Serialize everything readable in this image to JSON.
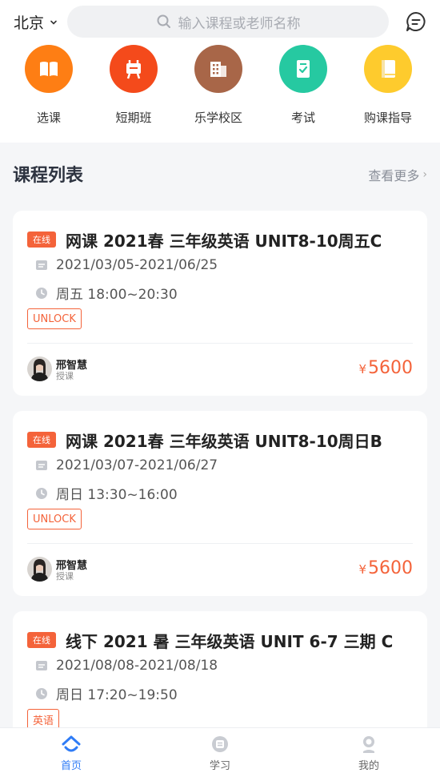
{
  "header": {
    "city": "北京",
    "search_placeholder": "输入课程或老师名称"
  },
  "categories": [
    {
      "label": "选课",
      "color": "#fe7e14",
      "icon": "book-icon"
    },
    {
      "label": "短期班",
      "color": "#f44a1b",
      "icon": "easel-icon"
    },
    {
      "label": "乐学校区",
      "color": "#a86648",
      "icon": "building-icon"
    },
    {
      "label": "考试",
      "color": "#26c9a1",
      "icon": "exam-icon"
    },
    {
      "label": "购课指导",
      "color": "#fecb2d",
      "icon": "guide-book-icon"
    }
  ],
  "section": {
    "title": "课程列表",
    "more": "查看更多"
  },
  "courses": [
    {
      "tag": "在线",
      "title": "网课 2021春 三年级英语 UNIT8-10周五C",
      "date": "2021/03/05-2021/06/25",
      "time": "周五  18:00~20:30",
      "badge": "UNLOCK",
      "teacher": "邢智慧",
      "role": "授课",
      "currency": "¥",
      "price": "5600"
    },
    {
      "tag": "在线",
      "title": "网课 2021春 三年级英语 UNIT8-10周日B",
      "date": "2021/03/07-2021/06/27",
      "time": "周日  13:30~16:00",
      "badge": "UNLOCK",
      "teacher": "邢智慧",
      "role": "授课",
      "currency": "¥",
      "price": "5600"
    },
    {
      "tag": "在线",
      "title": "线下 2021 暑 三年级英语 UNIT 6-7 三期 C",
      "date": "2021/08/08-2021/08/18",
      "time": "周日  17:20~19:50",
      "badge": "英语"
    }
  ],
  "tabs": [
    {
      "label": "首页",
      "icon": "home-icon",
      "active": true
    },
    {
      "label": "学习",
      "icon": "study-icon",
      "active": false
    },
    {
      "label": "我的",
      "icon": "profile-icon",
      "active": false
    }
  ],
  "colors": {
    "accent": "#f4633a",
    "tab_active": "#2f7cf6"
  }
}
